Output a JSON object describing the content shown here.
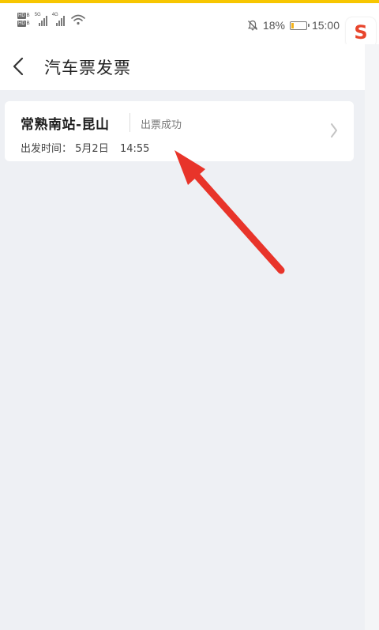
{
  "status_bar": {
    "sim1": {
      "badge": "HD",
      "num": "B"
    },
    "sim2": {
      "badge": "HD",
      "num": "B"
    },
    "net1": "5G",
    "net2": "4G",
    "battery_percent": "18%",
    "battery_level": 0.18,
    "time": "15:00",
    "icons": [
      "wifi-icon",
      "mute-icon",
      "battery-icon"
    ],
    "accent_color": "#f7c600"
  },
  "ime_logo": "S",
  "header": {
    "title": "汽车票发票"
  },
  "ticket": {
    "route": "常熟南站-昆山",
    "status": "出票成功",
    "departure_label": "出发时间：",
    "departure_date": "5月2日",
    "departure_time": "14:55"
  },
  "annotation": {
    "arrow_color": "#e8342a"
  }
}
